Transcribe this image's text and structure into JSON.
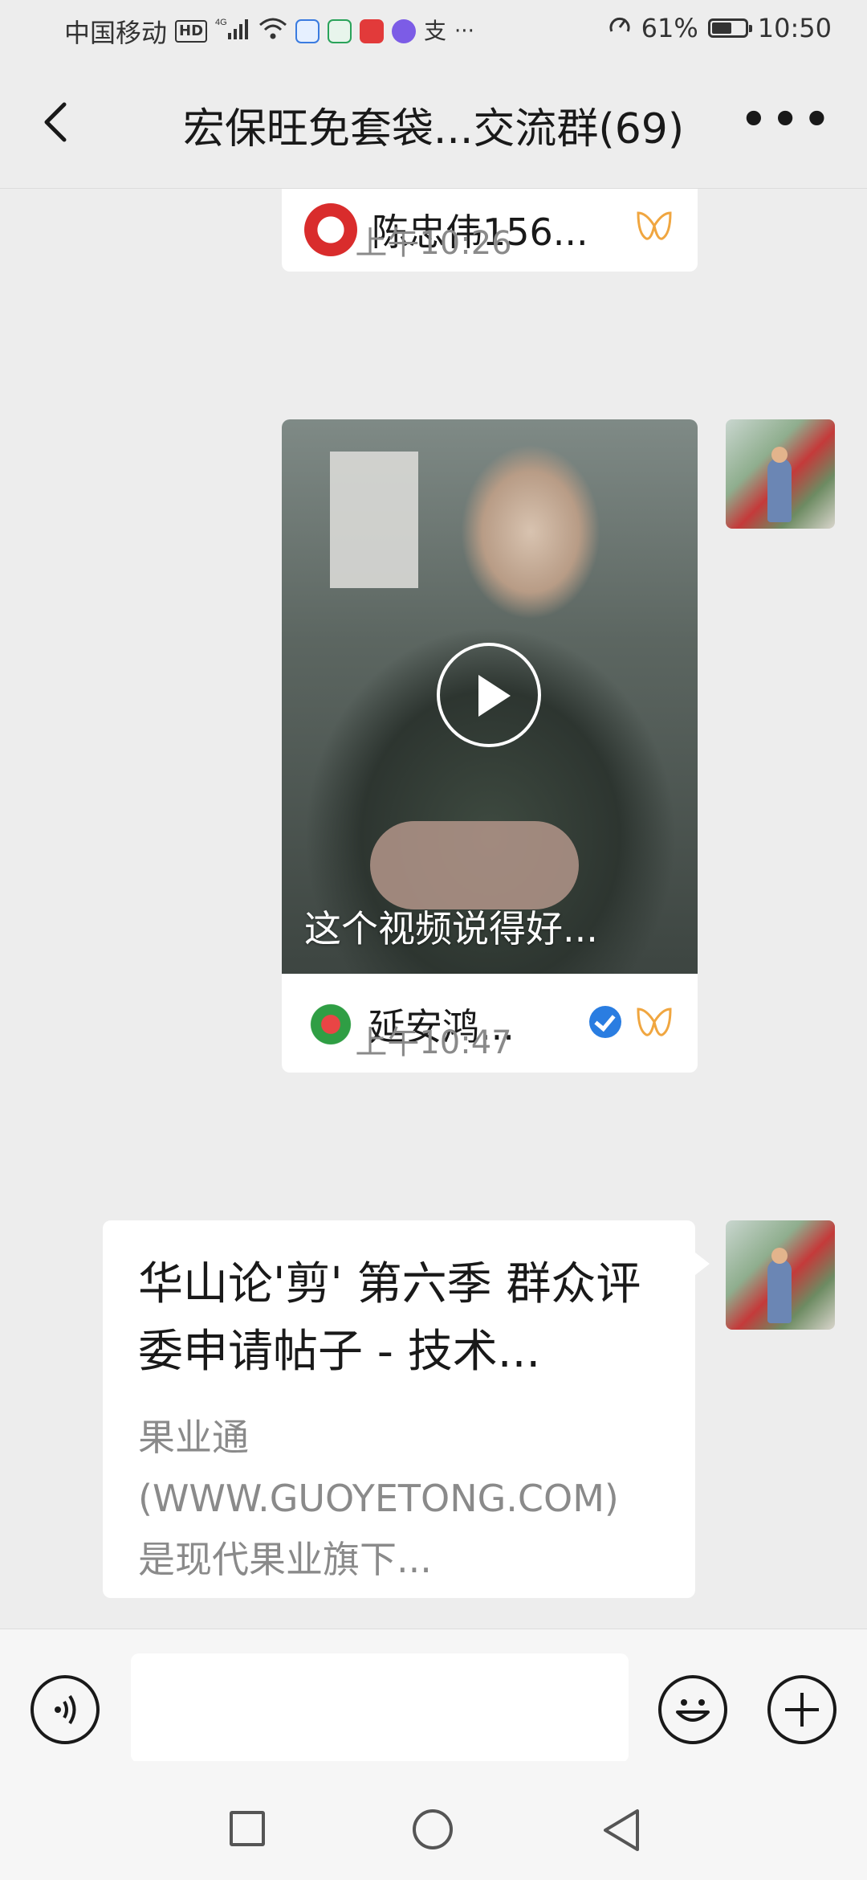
{
  "status_bar": {
    "carrier": "中国移动",
    "hd": "HD",
    "network": "4G",
    "battery_percent": "61%",
    "battery_level": 0.61,
    "time": "10:50"
  },
  "nav": {
    "title": "宏保旺免套袋...交流群(69)"
  },
  "messages": {
    "top_card_author": "陈忠伟156...",
    "time1": "上午10:26",
    "video_caption": "这个视频说得好...",
    "video_author": "延安鸿...",
    "time2": "上午10:47",
    "link_title": "华山论'剪' 第六季 群众评委申请帖子 - 技术...",
    "link_desc": "果业通(WWW.GUOYETONG.COM)是现代果业旗下..."
  },
  "colors": {
    "background": "#ededed",
    "bubble": "#ffffff",
    "timestamp": "#8a8a8a",
    "verified": "#2a7de1",
    "channels": "#f0a640"
  }
}
